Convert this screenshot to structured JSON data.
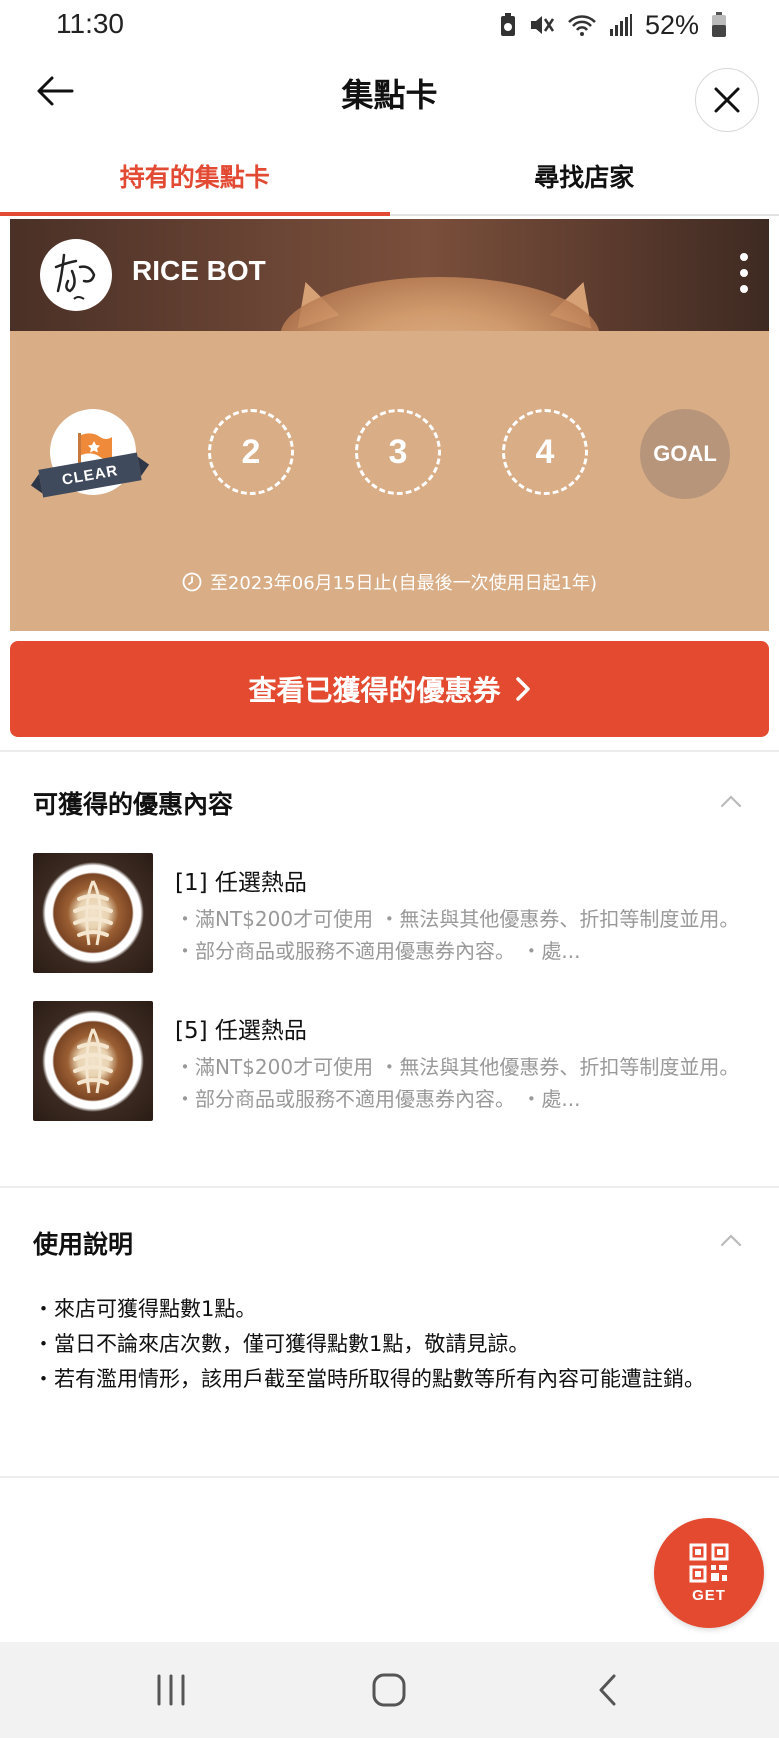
{
  "status_bar": {
    "time": "11:30",
    "battery": "52%"
  },
  "header": {
    "title": "集點卡"
  },
  "tabs": [
    {
      "label": "持有的集點卡",
      "active": true
    },
    {
      "label": "尋找店家",
      "active": false
    }
  ],
  "card": {
    "store_name": "RICE BOT",
    "stamps": [
      {
        "type": "clear",
        "label": "CLEAR"
      },
      {
        "type": "empty",
        "label": "2"
      },
      {
        "type": "empty",
        "label": "3"
      },
      {
        "type": "empty",
        "label": "4"
      },
      {
        "type": "goal",
        "label": "GOAL"
      }
    ],
    "validity": "至2023年06月15日止(自最後一次使用日起1年)",
    "background_color": "#d9ad86"
  },
  "coupon_button": {
    "label": "查看已獲得的優惠券"
  },
  "rewards_section": {
    "title": "可獲得的優惠內容",
    "items": [
      {
        "title": "[1] 任選熱品",
        "description": "・滿NT$200才可使用 ・無法與其他優惠券、折扣等制度並用。 ・部分商品或服務不適用優惠券內容。 ・處..."
      },
      {
        "title": "[5] 任選熱品",
        "description": "・滿NT$200才可使用 ・無法與其他優惠券、折扣等制度並用。 ・部分商品或服務不適用優惠券內容。 ・處..."
      }
    ]
  },
  "instructions_section": {
    "title": "使用說明",
    "lines": [
      "・來店可獲得點數1點。",
      "・當日不論來店次數，僅可獲得點數1點，敬請見諒。",
      "・若有濫用情形，該用戶截至當時所取得的點數等所有內容可能遭註銷。"
    ]
  },
  "fab": {
    "label": "GET"
  },
  "colors": {
    "accent": "#e34a2f",
    "tab_active": "#e34a33"
  }
}
